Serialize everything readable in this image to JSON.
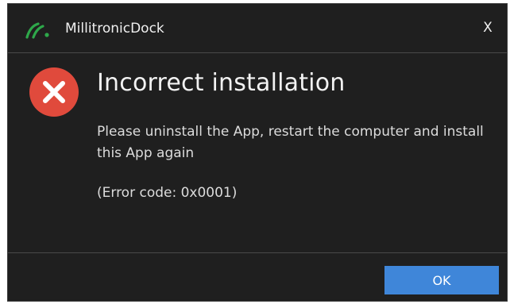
{
  "window": {
    "title": "MillitronicDock",
    "close_label": "X",
    "logo_icon": "millitronic-logo-icon",
    "logo_color": "#2ea84a"
  },
  "dialog": {
    "icon": "error-icon",
    "icon_color": "#e04a3c",
    "heading": "Incorrect installation",
    "message": "Please uninstall the App, restart the computer and install this App again",
    "error_code": "(Error code: 0x0001)"
  },
  "footer": {
    "ok_label": "OK",
    "ok_color": "#3f86d9"
  }
}
